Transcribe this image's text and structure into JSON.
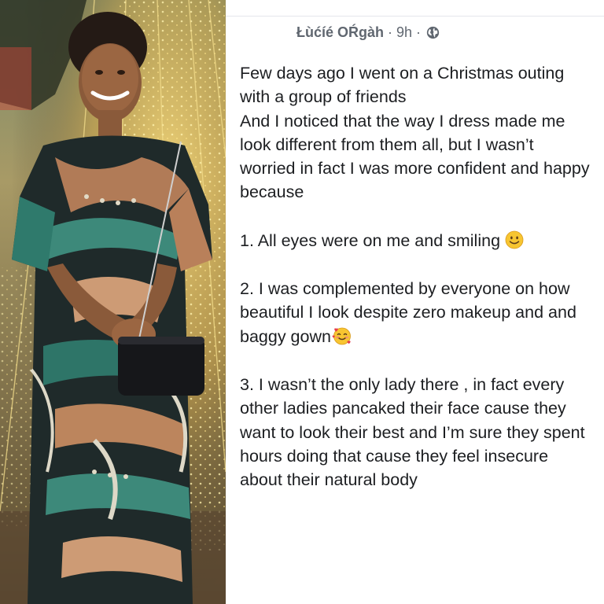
{
  "post": {
    "author": "Łùćíé ОŔgàh",
    "separator": "·",
    "time": "9h",
    "privacy_icon": "globe-icon",
    "paragraphs": {
      "intro": "Few days ago I went on a Christmas outing with a group of friends\nAnd I noticed that the way I dress made me look different from them all, but I wasn’t worried in fact I was more confident and happy because",
      "point1": "1. All eyes were on me and smiling",
      "point1_emoji": "slightly-smiling-face-emoji",
      "point2": "2. I was complemented by everyone on how beautiful I look despite zero makeup and and baggy gown",
      "point2_emoji": "smiling-face-with-hearts-emoji",
      "point3": "3. I wasn’t the only lady there , in fact every other ladies pancaked their face cause they want to look their best and I’m sure they spent hours doing that cause they feel insecure about their natural body"
    }
  },
  "photo": {
    "subject": "woman-in-patterned-dress-photo"
  },
  "colors": {
    "text": "#1c1e21",
    "meta": "#606770",
    "divider": "#e4e6eb",
    "emoji_yellow": "#f7c531"
  }
}
